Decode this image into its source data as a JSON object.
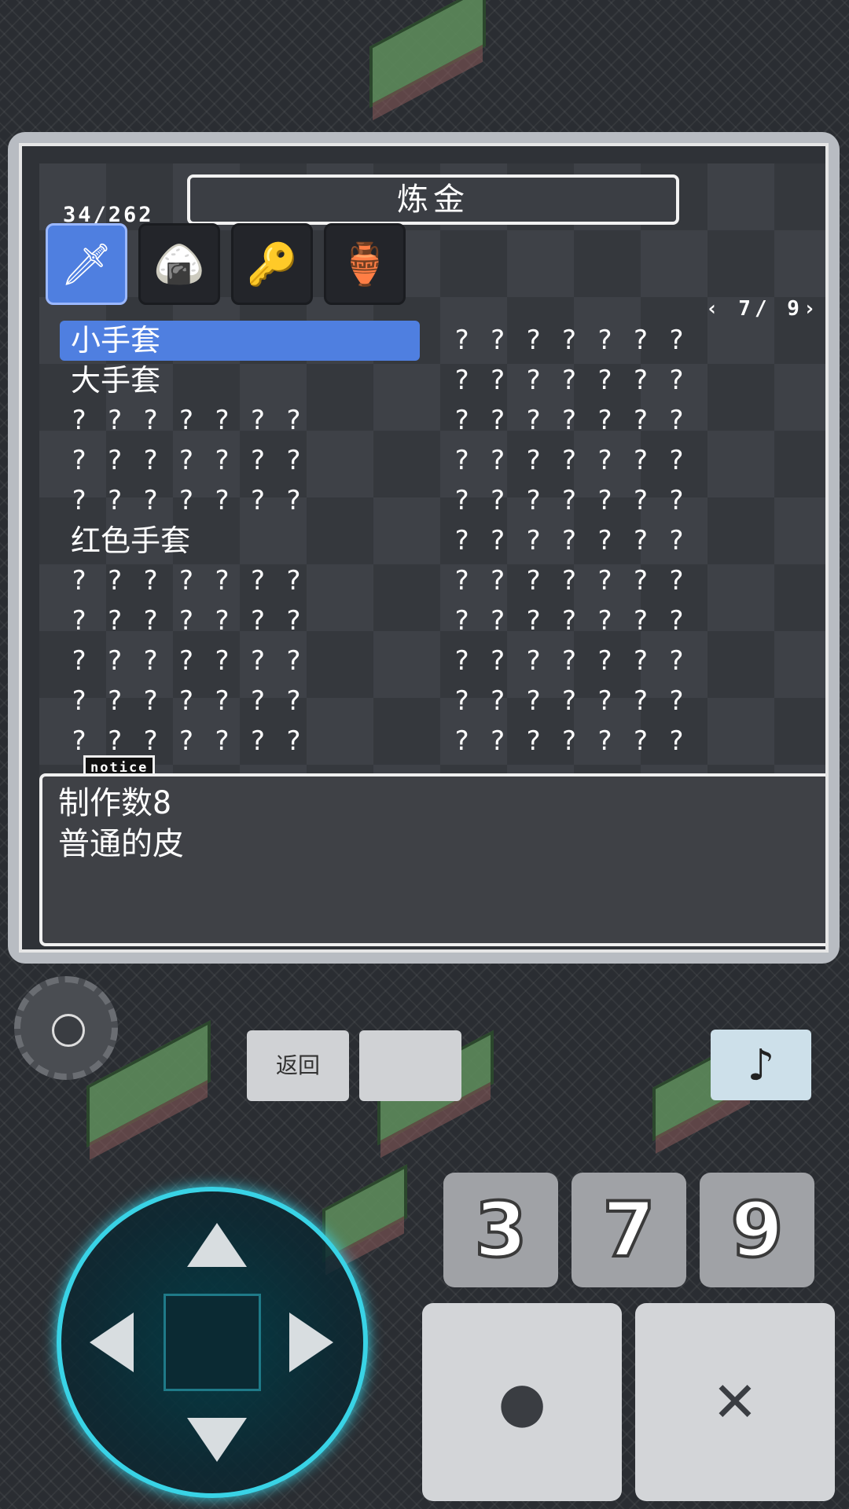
{
  "panel": {
    "title": "炼金",
    "count": "34/262",
    "pager": "‹ 7/ 9›",
    "tabs": [
      {
        "icon": "sword-icon",
        "glyph": "🗡",
        "active": true
      },
      {
        "icon": "onigiri-icon",
        "glyph": "🍙",
        "active": false
      },
      {
        "icon": "key-icon",
        "glyph": "🔑",
        "active": false
      },
      {
        "icon": "jar-icon",
        "glyph": "🏺",
        "active": false
      }
    ],
    "left_items": [
      {
        "label": "小手套",
        "selected": true
      },
      {
        "label": "大手套",
        "selected": false
      },
      {
        "label": "???????",
        "selected": false
      },
      {
        "label": "???????",
        "selected": false
      },
      {
        "label": "???????",
        "selected": false
      },
      {
        "label": "红色手套",
        "selected": false
      },
      {
        "label": "???????",
        "selected": false
      },
      {
        "label": "???????",
        "selected": false
      },
      {
        "label": "???????",
        "selected": false
      },
      {
        "label": "???????",
        "selected": false
      },
      {
        "label": "???????",
        "selected": false
      }
    ],
    "right_items": [
      "???????",
      "???????",
      "???????",
      "???????",
      "???????",
      "???????",
      "???????",
      "???????",
      "???????",
      "???????",
      "???????"
    ]
  },
  "notice": {
    "tag": "notice",
    "line1": "制作数8",
    "line2": "普通的皮"
  },
  "controls": {
    "back_label": "返回",
    "blank_label": "",
    "music_glyph": "♪",
    "num1": "3",
    "num2": "7",
    "num3": "9",
    "circle_glyph": "●",
    "cross_glyph": "✕"
  }
}
